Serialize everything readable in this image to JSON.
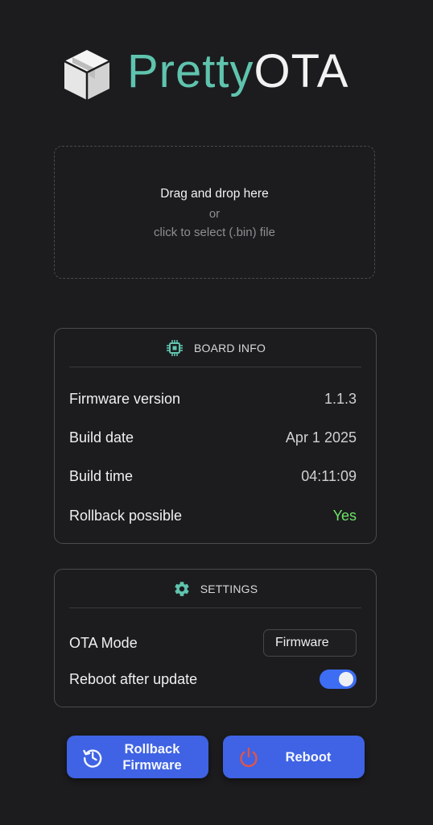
{
  "logo": {
    "word1": "Pretty",
    "word2": "OTA",
    "accent": "#5fc4ae"
  },
  "dropzone": {
    "line1": "Drag and drop here",
    "line2": "or",
    "line3": "click to select (.bin) file"
  },
  "board_info": {
    "title": "BOARD INFO",
    "icon": "chip-icon",
    "rows": [
      {
        "key": "Firmware version",
        "value": "1.1.3"
      },
      {
        "key": "Build date",
        "value": "Apr 1 2025"
      },
      {
        "key": "Build time",
        "value": "04:11:09"
      },
      {
        "key": "Rollback possible",
        "value": "Yes"
      }
    ]
  },
  "settings": {
    "title": "SETTINGS",
    "icon": "gear-icon",
    "ota_mode_label": "OTA Mode",
    "ota_mode_value": "Firmware",
    "reboot_label": "Reboot after update",
    "reboot_on": true
  },
  "buttons": {
    "rollback_line1": "Rollback",
    "rollback_line2": "Firmware",
    "reboot": "Reboot",
    "color": "#3f63e4"
  },
  "colors": {
    "background": "#1c1c1e",
    "yes": "#6fe36a",
    "toggle": "#3d6df2",
    "power": "#e05548"
  }
}
